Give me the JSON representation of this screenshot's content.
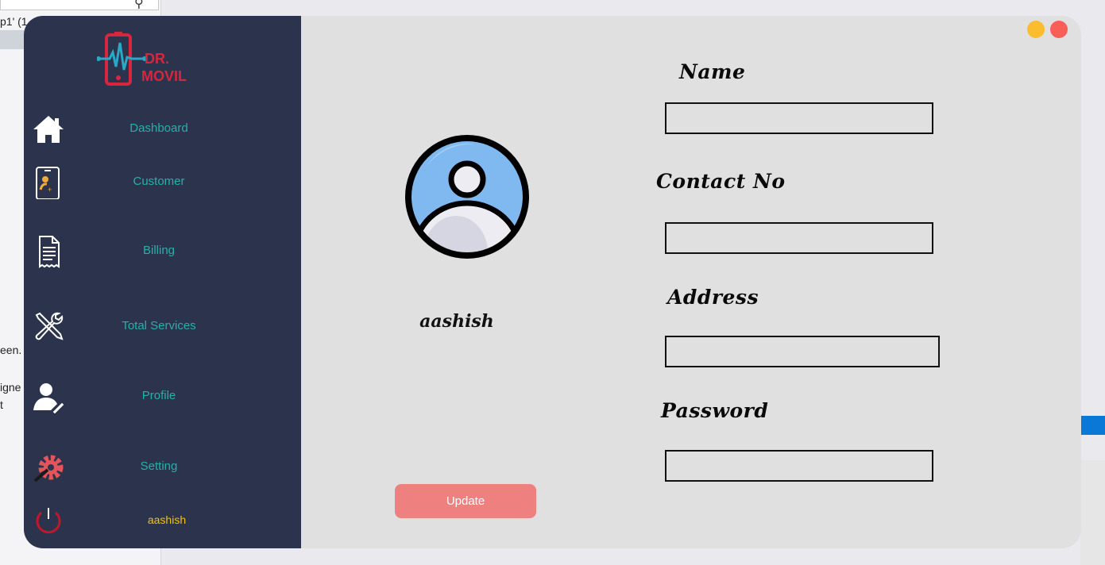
{
  "background": {
    "text_lines": [
      "p1' (1",
      "een.",
      "igne",
      "t"
    ]
  },
  "app": {
    "logo": {
      "line1": "DR.",
      "line2": "MOVIL",
      "icon": "phone-heartbeat-logo"
    },
    "colors": {
      "sidebar": "#2b344c",
      "nav_text": "#26b0aa",
      "content_bg": "#e0e0e0",
      "update_button": "#ee8080",
      "logout_text": "#f4c300"
    },
    "nav": [
      {
        "label": "Dashboard",
        "icon": "home-icon"
      },
      {
        "label": "Customer",
        "icon": "customer-card-icon"
      },
      {
        "label": "Billing",
        "icon": "receipt-icon"
      },
      {
        "label": "Total Services",
        "icon": "tools-icon"
      },
      {
        "label": "Profile",
        "icon": "user-edit-icon"
      },
      {
        "label": "Setting",
        "icon": "gear-icon"
      }
    ],
    "logout": {
      "label": "aashish",
      "icon": "power-icon"
    }
  },
  "profile": {
    "username": "aashish",
    "fields": {
      "name": {
        "label": "Name",
        "value": ""
      },
      "contact": {
        "label": "Contact No",
        "value": ""
      },
      "address": {
        "label": "Address",
        "value": ""
      },
      "password": {
        "label": "Password",
        "value": ""
      }
    },
    "update_label": "Update"
  }
}
